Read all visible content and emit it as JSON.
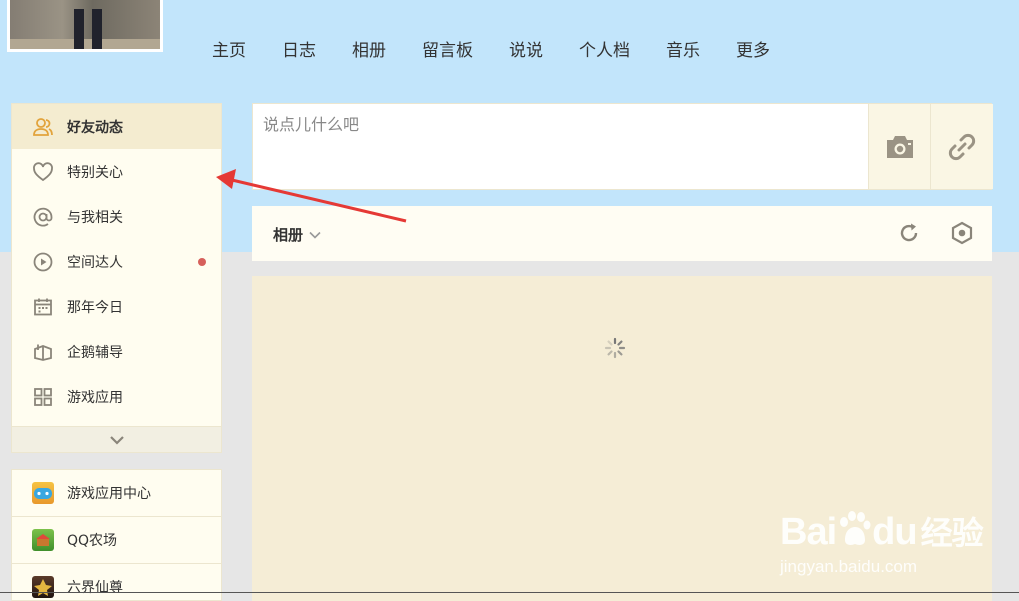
{
  "nav": {
    "items": [
      {
        "label": "主页"
      },
      {
        "label": "日志"
      },
      {
        "label": "相册"
      },
      {
        "label": "留言板"
      },
      {
        "label": "说说"
      },
      {
        "label": "个人档"
      },
      {
        "label": "音乐"
      },
      {
        "label": "更多"
      }
    ]
  },
  "sidebar": {
    "items": [
      {
        "label": "好友动态",
        "icon": "friends-icon",
        "active": true
      },
      {
        "label": "特别关心",
        "icon": "heart-icon"
      },
      {
        "label": "与我相关",
        "icon": "at-icon"
      },
      {
        "label": "空间达人",
        "icon": "play-circle-icon",
        "badge": true
      },
      {
        "label": "那年今日",
        "icon": "calendar-icon"
      },
      {
        "label": "企鹅辅导",
        "icon": "book-icon"
      },
      {
        "label": "游戏应用",
        "icon": "apps-grid-icon"
      }
    ]
  },
  "apps": {
    "items": [
      {
        "label": "游戏应用中心",
        "icon": "game-center-icon"
      },
      {
        "label": "QQ农场",
        "icon": "farm-icon"
      },
      {
        "label": "六界仙尊",
        "icon": "immortal-game-icon"
      }
    ]
  },
  "post": {
    "placeholder": "说点儿什么吧"
  },
  "feed": {
    "filter_label": "相册"
  },
  "watermark": {
    "logo_text": "Bai",
    "logo_text2": "du",
    "logo_suffix": "经验",
    "url": "jingyan.baidu.com"
  },
  "colors": {
    "header_bg": "#c2e5fb",
    "sidebar_bg": "#fffdf0",
    "active_bg": "#f4ecd0",
    "feed_bg": "#f5edd6",
    "annotation_arrow": "#e53935",
    "badge_dot": "#d6605b"
  }
}
